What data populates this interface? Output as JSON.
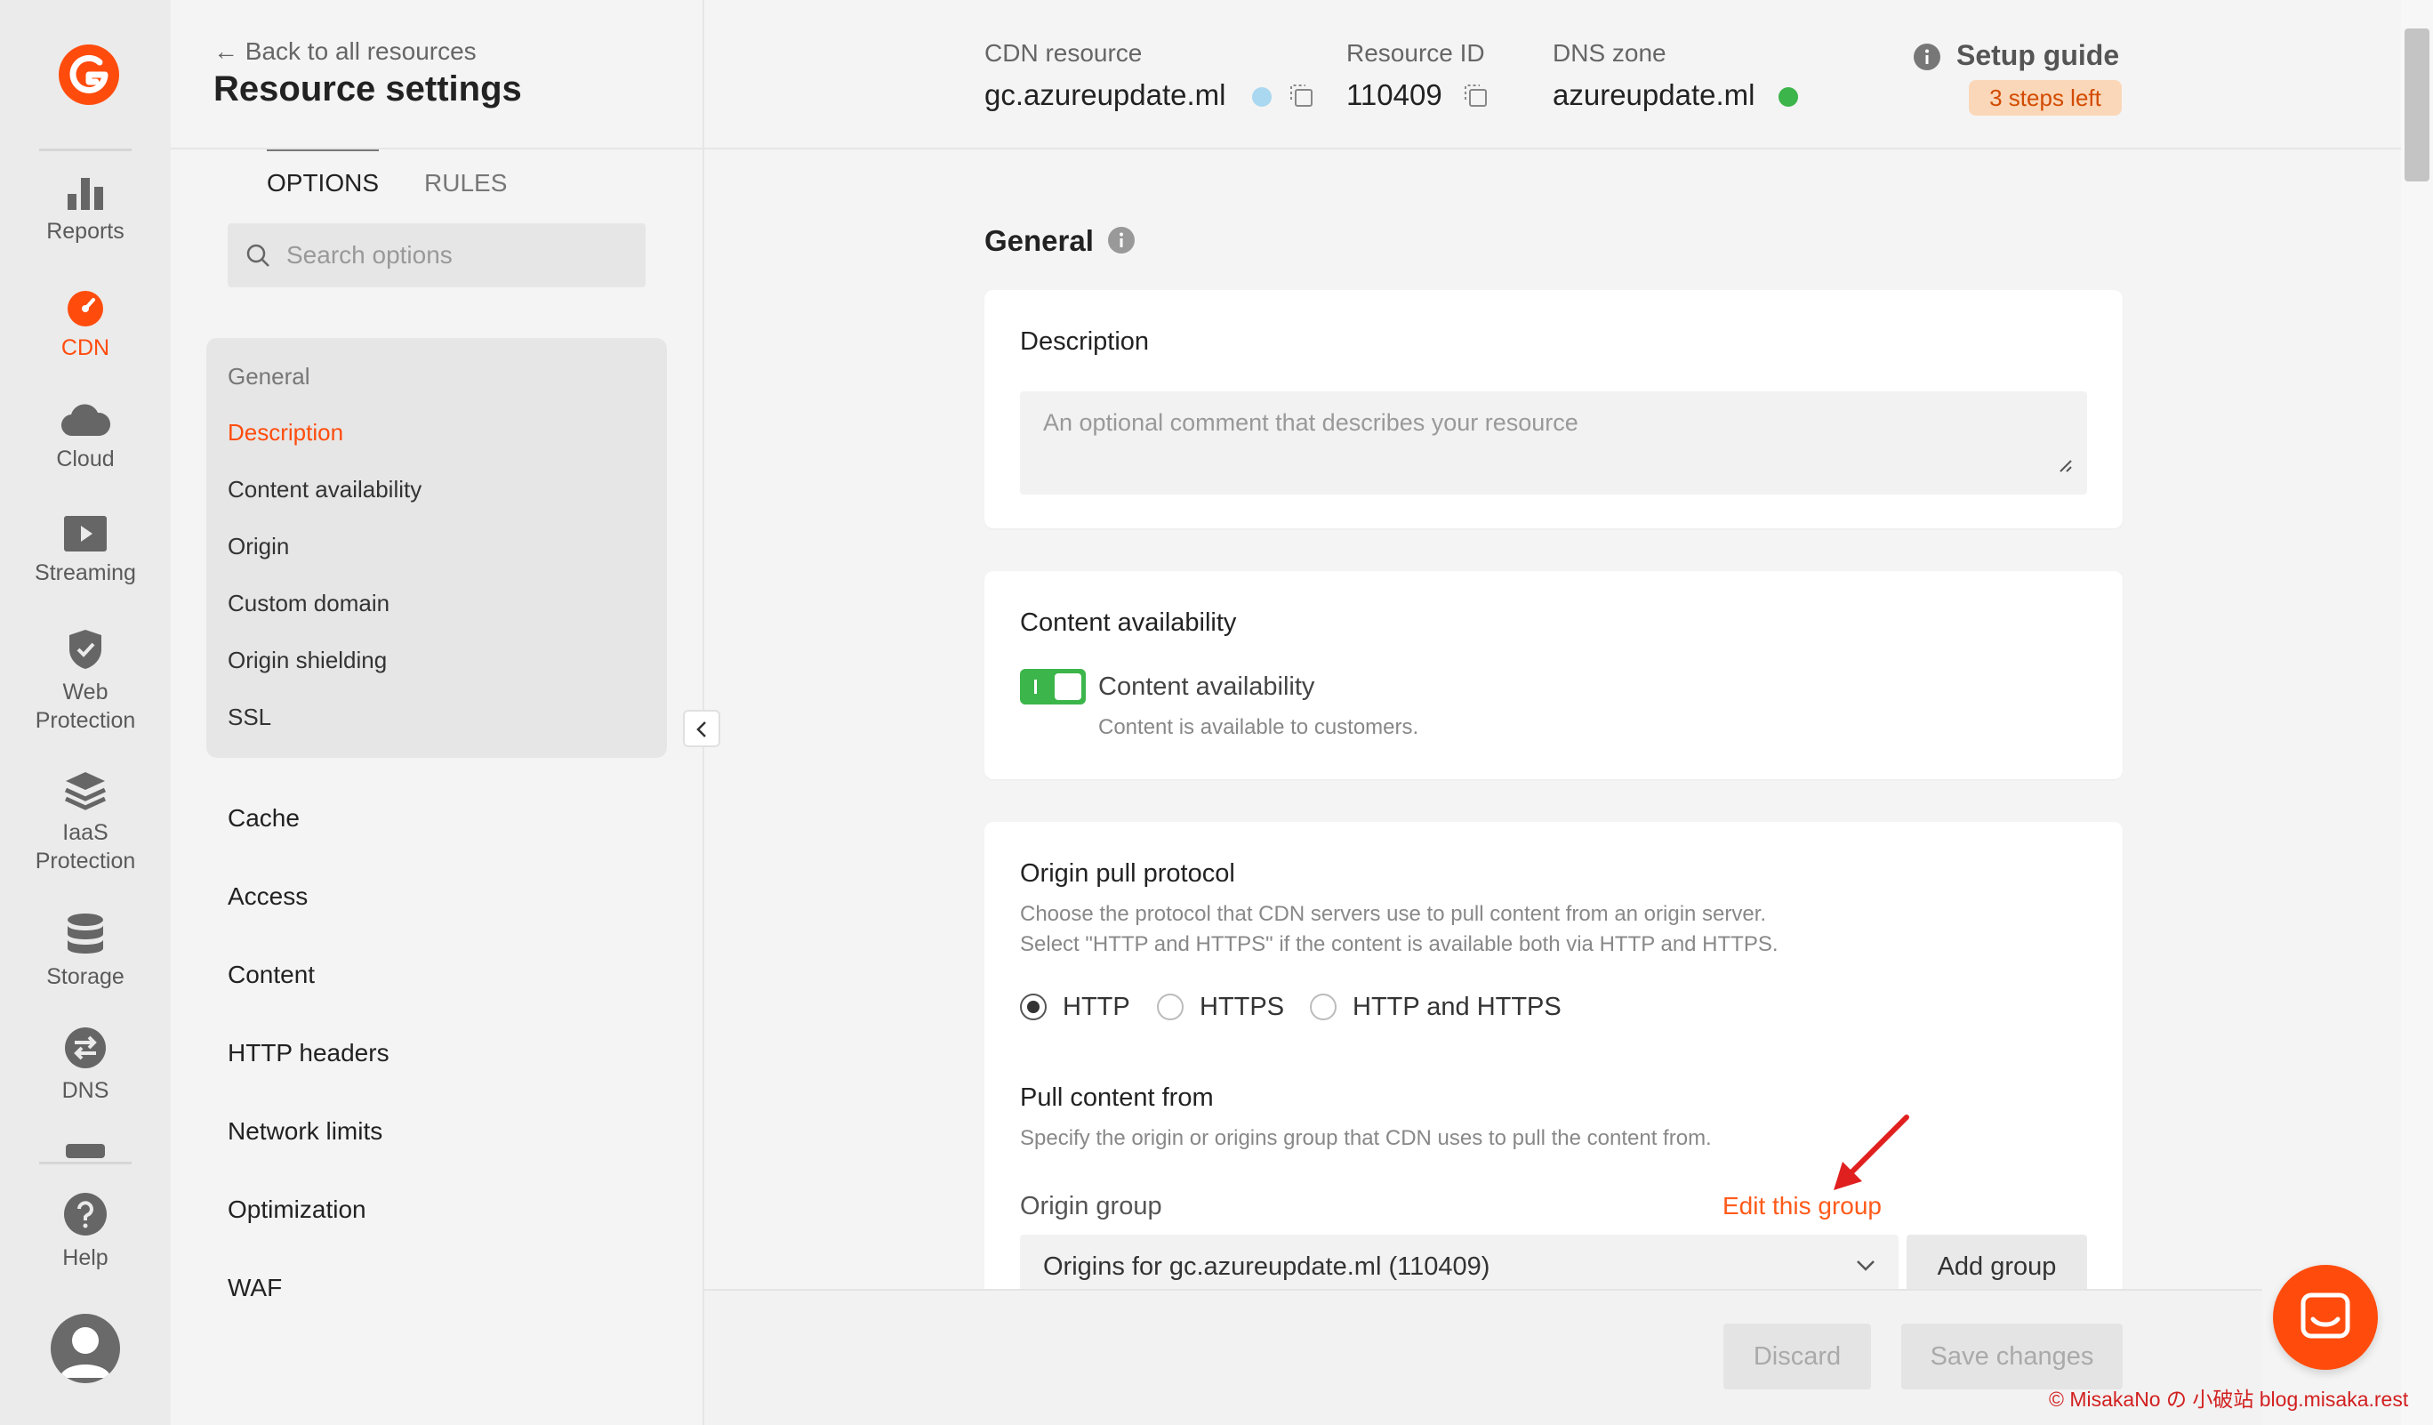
{
  "rail": {
    "items": [
      {
        "label": "Reports",
        "icon": "bar-chart-icon"
      },
      {
        "label": "CDN",
        "icon": "speedometer-icon"
      },
      {
        "label": "Cloud",
        "icon": "cloud-icon"
      },
      {
        "label": "Streaming",
        "icon": "play-icon"
      },
      {
        "label_line1": "Web",
        "label_line2": "Protection",
        "icon": "shield-check-icon"
      },
      {
        "label_line1": "IaaS",
        "label_line2": "Protection",
        "icon": "layers-icon"
      },
      {
        "label": "Storage",
        "icon": "database-icon"
      },
      {
        "label": "DNS",
        "icon": "swap-arrows-icon"
      },
      {
        "label": "Help",
        "icon": "question-icon"
      }
    ]
  },
  "sidebar": {
    "back_link": "Back to all resources",
    "title": "Resource settings",
    "tabs": [
      "OPTIONS",
      "RULES"
    ],
    "search_placeholder": "Search options",
    "general_group": [
      "General",
      "Description",
      "Content availability",
      "Origin",
      "Custom domain",
      "Origin shielding",
      "SSL"
    ],
    "sections": [
      "Cache",
      "Access",
      "Content",
      "HTTP headers",
      "Network limits",
      "Optimization",
      "WAF"
    ]
  },
  "header": {
    "cdn_label": "CDN resource",
    "cdn_value": "gc.azureupdate.ml",
    "id_label": "Resource ID",
    "id_value": "110409",
    "dns_label": "DNS zone",
    "dns_value": "azureupdate.ml",
    "setup_guide": "Setup guide",
    "steps_left": "3 steps left"
  },
  "main": {
    "section_title": "General",
    "description": {
      "title": "Description",
      "placeholder": "An optional comment that describes your resource"
    },
    "availability": {
      "title": "Content availability",
      "toggle_label": "Content availability",
      "help": "Content is available to customers."
    },
    "origin": {
      "title": "Origin pull protocol",
      "help1": "Choose the protocol that CDN servers use to pull content from an origin server.",
      "help2": "Select \"HTTP and HTTPS\" if the content is available both via HTTP and HTTPS.",
      "options": [
        "HTTP",
        "HTTPS",
        "HTTP and HTTPS"
      ],
      "pull_title": "Pull content from",
      "pull_help": "Specify the origin or origins group that CDN uses to pull the content from.",
      "group_label": "Origin group",
      "edit_link": "Edit this group",
      "group_value": "Origins for gc.azureupdate.ml (110409)",
      "add_group": "Add group"
    }
  },
  "footer": {
    "discard": "Discard",
    "save": "Save changes"
  },
  "watermark": "© MisakaNo の 小破站 blog.misaka.rest",
  "colors": {
    "accent": "#ff4c0d",
    "toggle_on": "#3cb54a",
    "badge_bg": "#fad7b8",
    "dns_dot": "#3cb54a",
    "cdn_dot": "#a9d8f0"
  }
}
